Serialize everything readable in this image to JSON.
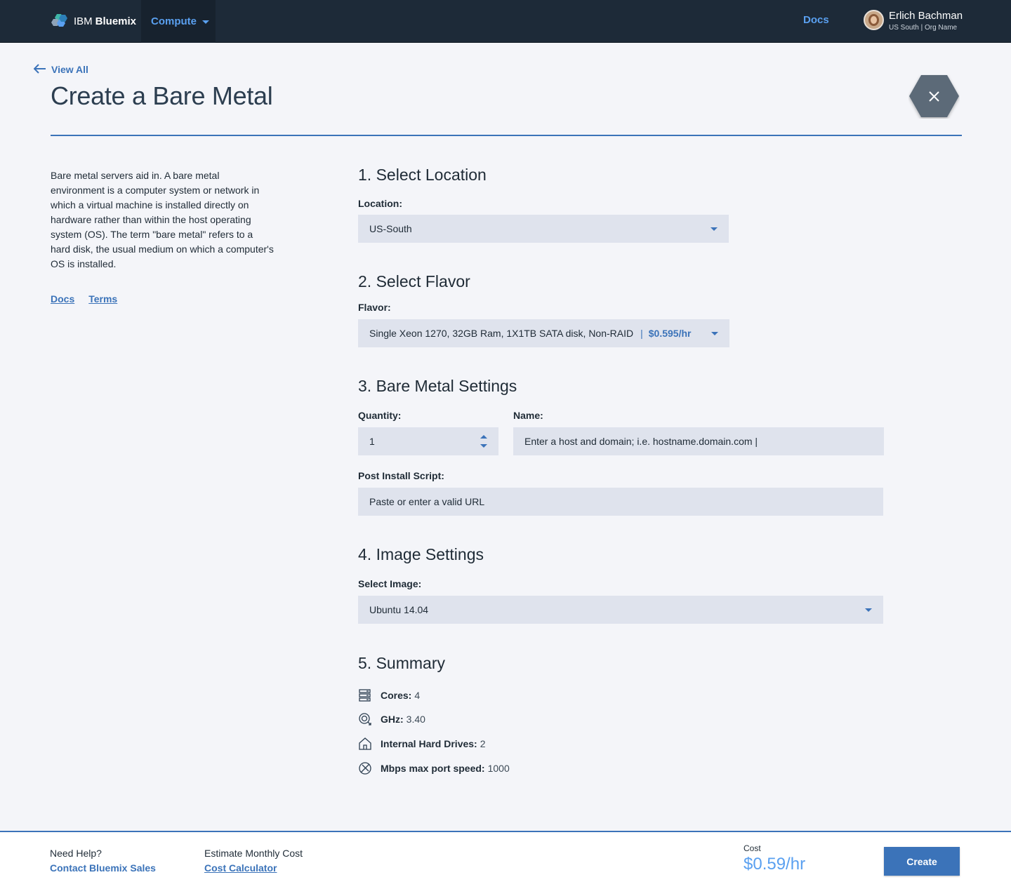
{
  "nav": {
    "brand_ibm": "IBM",
    "brand_bluemix": "Bluemix",
    "compute_label": "Compute",
    "docs_label": "Docs",
    "user_name": "Erlich Bachman",
    "user_org": "US South | Org Name"
  },
  "header": {
    "back_label": "View All",
    "page_title": "Create a Bare Metal",
    "accent_color": "#3b73b9"
  },
  "sidebar": {
    "description": "Bare metal servers aid in. A bare metal environment is a computer system or network in which a virtual machine is installed directly on hardware rather than within the host operating system (OS). The term \"bare metal\" refers to a hard disk, the usual medium on which a computer's OS is installed.",
    "links": [
      "Docs",
      "Terms"
    ]
  },
  "sections": {
    "location": {
      "title": "1. Select Location",
      "label": "Location:",
      "value": "US-South"
    },
    "flavor": {
      "title": "2. Select Flavor",
      "label": "Flavor:",
      "value": "Single Xeon 1270, 32GB Ram, 1X1TB SATA disk, Non-RAID",
      "separator": "|",
      "price": "$0.595/hr"
    },
    "settings": {
      "title": "3. Bare Metal Settings",
      "quantity_label": "Quantity:",
      "quantity_value": "1",
      "name_label": "Name:",
      "name_placeholder": "Enter a host and domain; i.e. hostname.domain.com |",
      "script_label": "Post Install Script:",
      "script_placeholder": "Paste or enter a valid URL"
    },
    "image": {
      "title": "4. Image Settings",
      "label": "Select Image:",
      "value": "Ubuntu 14.04"
    },
    "summary": {
      "title": "5. Summary",
      "items": [
        {
          "icon": "server-stack-icon",
          "label": "Cores:",
          "value": "4"
        },
        {
          "icon": "speed-gauge-icon",
          "label": "GHz:",
          "value": "3.40"
        },
        {
          "icon": "drive-house-icon",
          "label": "Internal Hard Drives:",
          "value": "2"
        },
        {
          "icon": "network-globe-icon",
          "label": "Mbps max port speed:",
          "value": "1000"
        }
      ]
    }
  },
  "footer": {
    "help_label": "Need Help?",
    "help_link": "Contact Bluemix Sales",
    "estimate_label": "Estimate Monthly Cost",
    "estimate_link": "Cost Calculator",
    "cost_label": "Cost",
    "cost_value": "$0.59/hr",
    "create_label": "Create"
  }
}
